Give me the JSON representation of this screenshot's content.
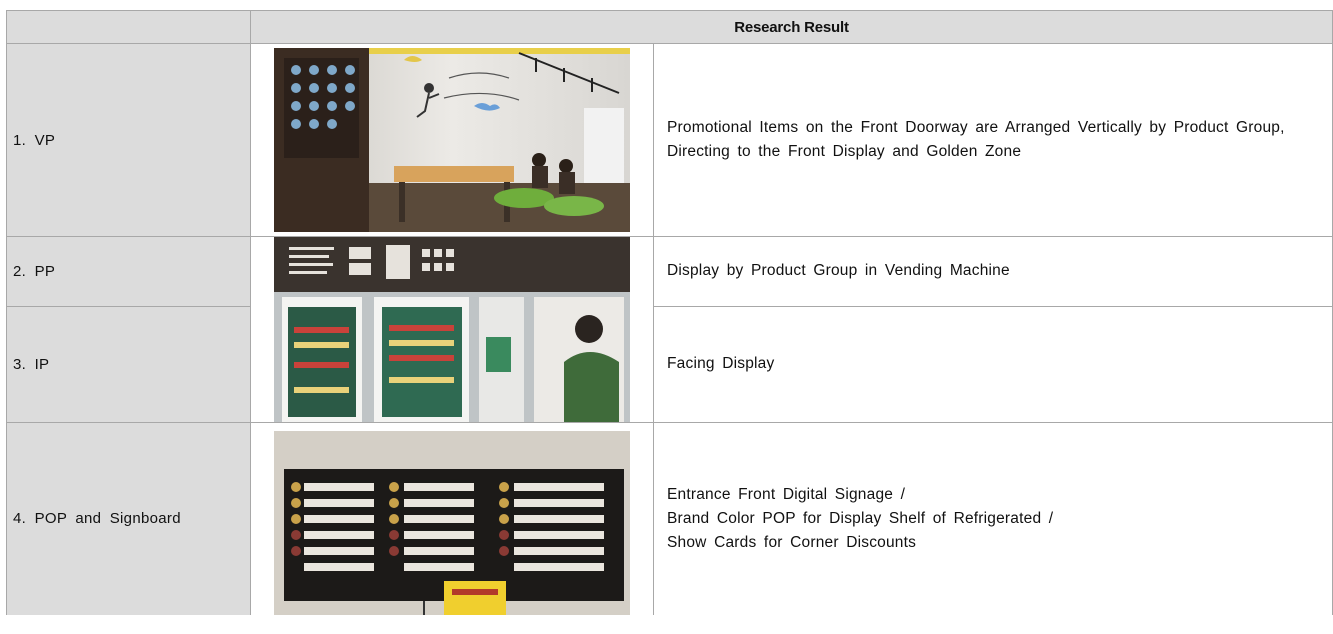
{
  "table": {
    "header": "Research Result",
    "rows": [
      {
        "label": "1. VP",
        "description": "Promotional Items on the Front Doorway are Arranged Vertically by Product Group, Directing to the Front Display and Golden Zone",
        "photo": "cafe-interior-photo"
      },
      {
        "label": "2. PP",
        "description": "Display by Product Group in Vending Machine",
        "photo": "vending-machine-photo"
      },
      {
        "label": "3. IP",
        "description": "Facing Display"
      },
      {
        "label": "4. POP and Signboard",
        "description_lines": [
          "Entrance Front Digital Signage /",
          "Brand Color POP for Display Shelf of Refrigerated /",
          "Show Cards for Corner Discounts"
        ],
        "photo": "signboard-photo"
      }
    ]
  },
  "colors": {
    "header_bg": "#dcdcdc",
    "border": "#a8a8a8"
  }
}
